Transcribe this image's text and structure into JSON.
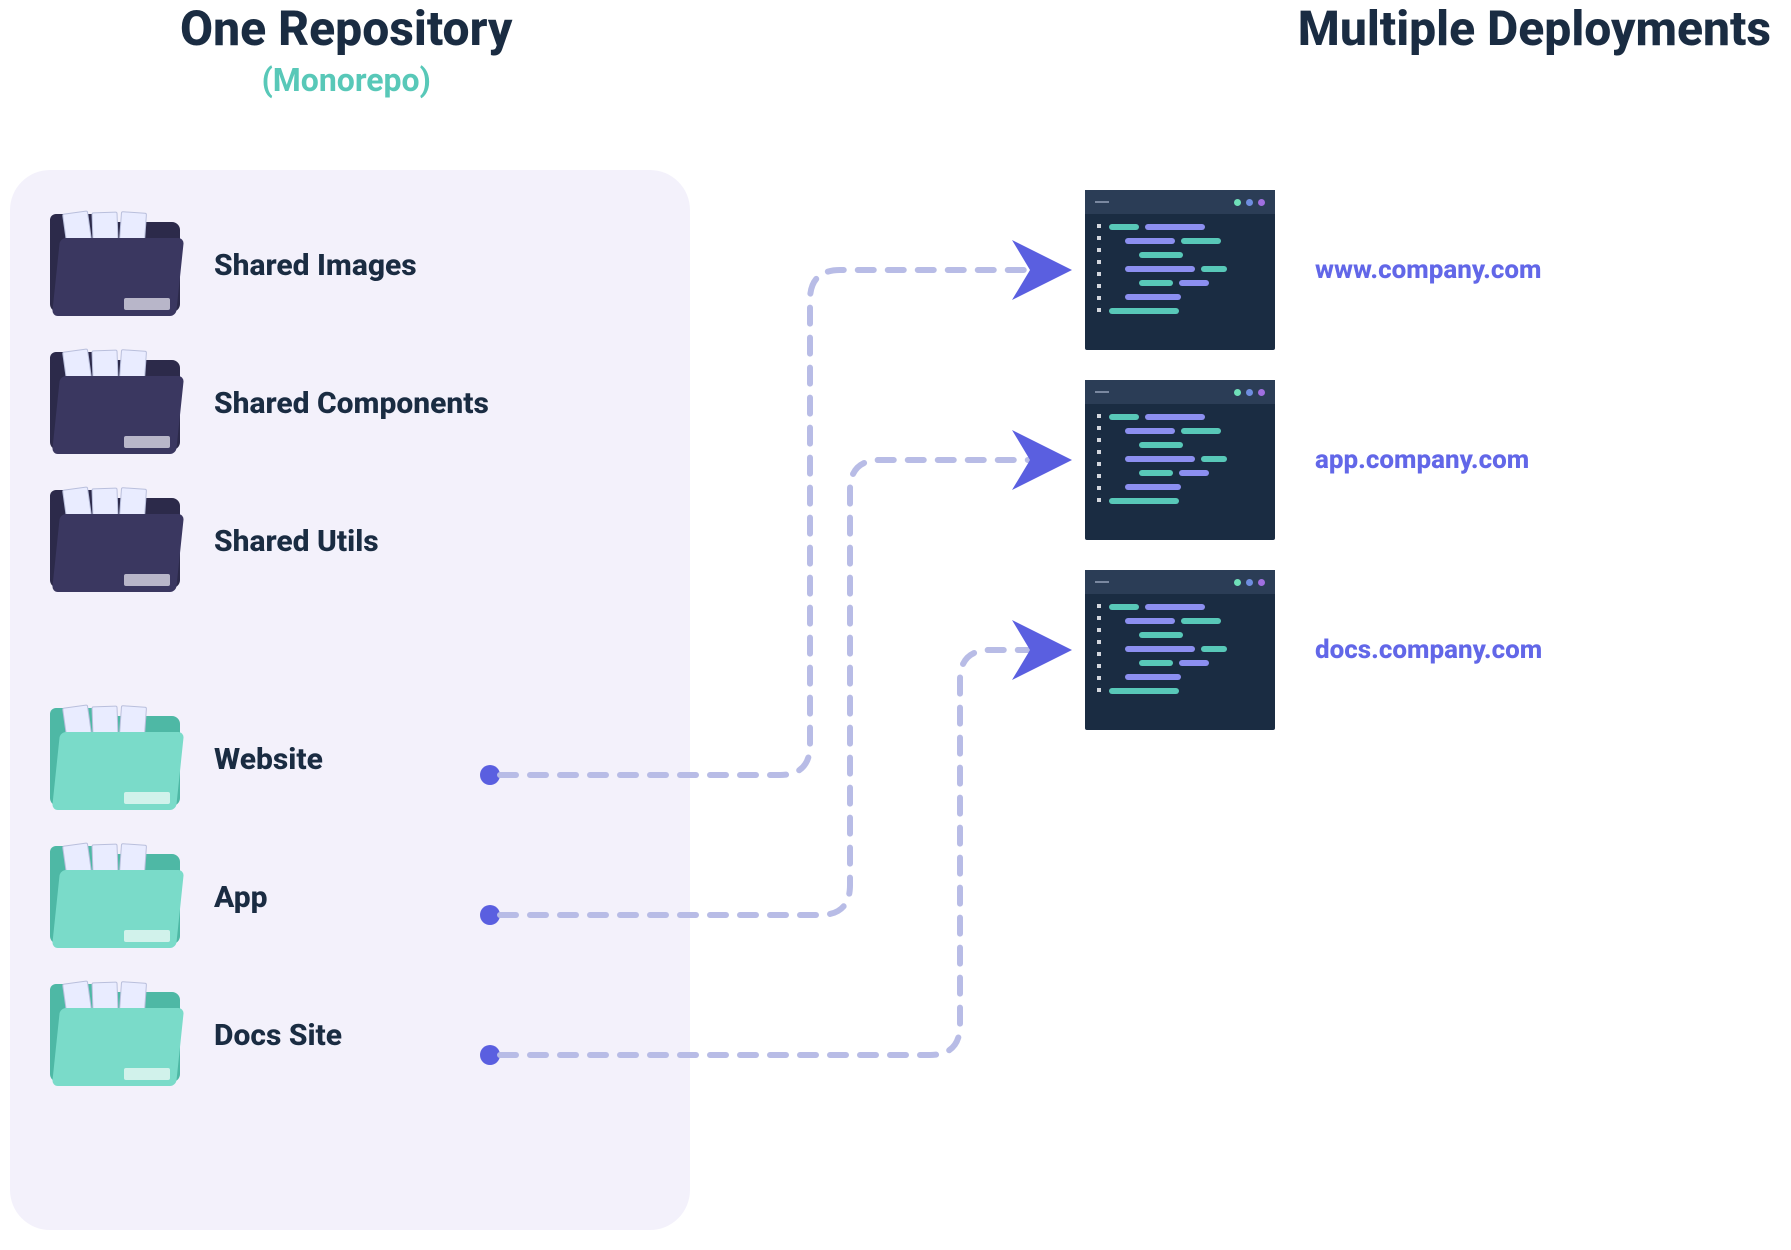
{
  "headings": {
    "left_title": "One Repository",
    "left_subtitle": "(Monorepo)",
    "right_title": "Multiple Deployments"
  },
  "shared_folders": [
    {
      "label": "Shared Images"
    },
    {
      "label": "Shared Components"
    },
    {
      "label": "Shared Utils"
    }
  ],
  "app_folders": [
    {
      "label": "Website"
    },
    {
      "label": "App"
    },
    {
      "label": "Docs Site"
    }
  ],
  "deployments": [
    {
      "url": "www.company.com"
    },
    {
      "url": "app.company.com"
    },
    {
      "url": "docs.company.com"
    }
  ],
  "colors": {
    "accent_purple": "#6267e8",
    "accent_teal": "#58c8b8",
    "text_dark": "#1a2c42",
    "panel_bg": "#f3f1fb"
  }
}
